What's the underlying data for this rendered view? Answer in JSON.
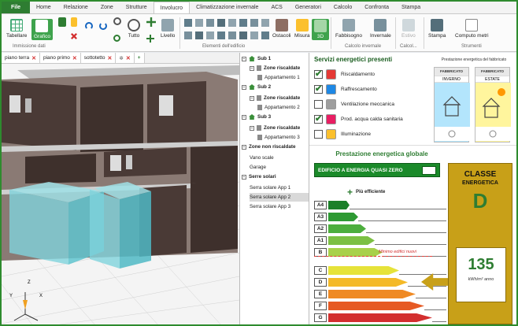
{
  "menu": {
    "file": "File",
    "tabs": [
      "Home",
      "Relazione",
      "Zone",
      "Strutture",
      "Involucro",
      "Climatizzazione invernale",
      "ACS",
      "Generatori",
      "Calcolo",
      "Confronta",
      "Stampa"
    ],
    "active_index": 4
  },
  "ribbon": {
    "tabellare": "Tabellare",
    "grafico": "Grafico",
    "tutto": "Tutto",
    "livello": "Livello",
    "ostacoli": "Ostacoli",
    "misura": "Misura",
    "view3d": "3D",
    "fabbisogno": "Fabbisogno",
    "invernale": "Invernale",
    "estivo": "Estivo",
    "stampa": "Stampa",
    "computo": "Computo metri",
    "group_immissione": "Immissione dati",
    "group_elementi": "Elementi dell'edificio",
    "group_calcolo": "Calcolo invernale",
    "group_calcolo2": "Calcol...",
    "group_strumenti": "Strumenti"
  },
  "view_tabs": [
    "piano terra",
    "piano primo",
    "sottotetto"
  ],
  "tree": [
    {
      "label": "Sub 1",
      "level": 0,
      "bold": true,
      "kind": "house"
    },
    {
      "label": "Zone riscaldate",
      "level": 1,
      "bold": true,
      "kind": "zone"
    },
    {
      "label": "Appartamento 1",
      "level": 2,
      "bold": false,
      "kind": "ap"
    },
    {
      "label": "Sub 2",
      "level": 0,
      "bold": true,
      "kind": "house"
    },
    {
      "label": "Zone riscaldate",
      "level": 1,
      "bold": true,
      "kind": "zone"
    },
    {
      "label": "Appartamento 2",
      "level": 2,
      "bold": false,
      "kind": "ap"
    },
    {
      "label": "Sub 3",
      "level": 0,
      "bold": true,
      "kind": "house"
    },
    {
      "label": "Zone riscaldate",
      "level": 1,
      "bold": true,
      "kind": "zone"
    },
    {
      "label": "Appartamento 3",
      "level": 2,
      "bold": false,
      "kind": "ap"
    },
    {
      "label": "Zone non riscaldate",
      "level": 0,
      "bold": true,
      "kind": "none"
    },
    {
      "label": "Vano scale",
      "level": 1,
      "bold": false,
      "kind": "none"
    },
    {
      "label": "Garage",
      "level": 1,
      "bold": false,
      "kind": "none"
    },
    {
      "label": "Serre solari",
      "level": 0,
      "bold": true,
      "kind": "none"
    },
    {
      "label": "Serra solare App 1",
      "level": 1,
      "bold": false,
      "kind": "none"
    },
    {
      "label": "Serra solare App 2",
      "level": 1,
      "bold": false,
      "kind": "none",
      "selected": true
    },
    {
      "label": "Serra solare App 3",
      "level": 1,
      "bold": false,
      "kind": "none"
    }
  ],
  "services": {
    "title": "Servizi energetici presenti",
    "items": [
      {
        "label": "Riscaldamento",
        "checked": true,
        "icon_color": "#e53935"
      },
      {
        "label": "Raffrescamento",
        "checked": true,
        "icon_color": "#1e88e5"
      },
      {
        "label": "Ventilazione meccanica",
        "checked": false,
        "icon_color": "#9e9e9e"
      },
      {
        "label": "Prod. acqua calda sanitaria",
        "checked": true,
        "icon_color": "#e91e63"
      },
      {
        "label": "Illuminazione",
        "checked": false,
        "icon_color": "#fbc02d"
      }
    ]
  },
  "fabbricato": {
    "title": "Prestazione energetica del fabbricato",
    "inverno_header": "FABBRICATO",
    "inverno": "INVERNO",
    "estate_header": "FABBRICATO",
    "estate": "ESTATE"
  },
  "globale": {
    "title": "Prestazione energetica globale",
    "nzeb": "EDIFICIO A ENERGIA QUASI ZERO",
    "piu": "Più efficiente",
    "minimo": "Minimo edifici nuovi",
    "levels": [
      "A4",
      "A3",
      "A2",
      "A1",
      "B",
      "C",
      "D",
      "E",
      "F",
      "G"
    ],
    "level_colors": [
      "#1b7f2a",
      "#2e9a33",
      "#4cae3d",
      "#7cc043",
      "#a8d14a",
      "#e6e33a",
      "#f4b927",
      "#ef8a24",
      "#e65a24",
      "#d32f2f"
    ],
    "level_bar_widths": [
      0.18,
      0.25,
      0.32,
      0.39,
      0.46,
      0.6,
      0.67,
      0.74,
      0.81,
      0.88
    ]
  },
  "classe": {
    "title": "CLASSE",
    "subtitle": "ENERGETICA",
    "value": "D",
    "number": "135",
    "unit": "kWh/m² anno"
  },
  "axes": {
    "z": "Z",
    "y": "Y",
    "x": "X"
  }
}
